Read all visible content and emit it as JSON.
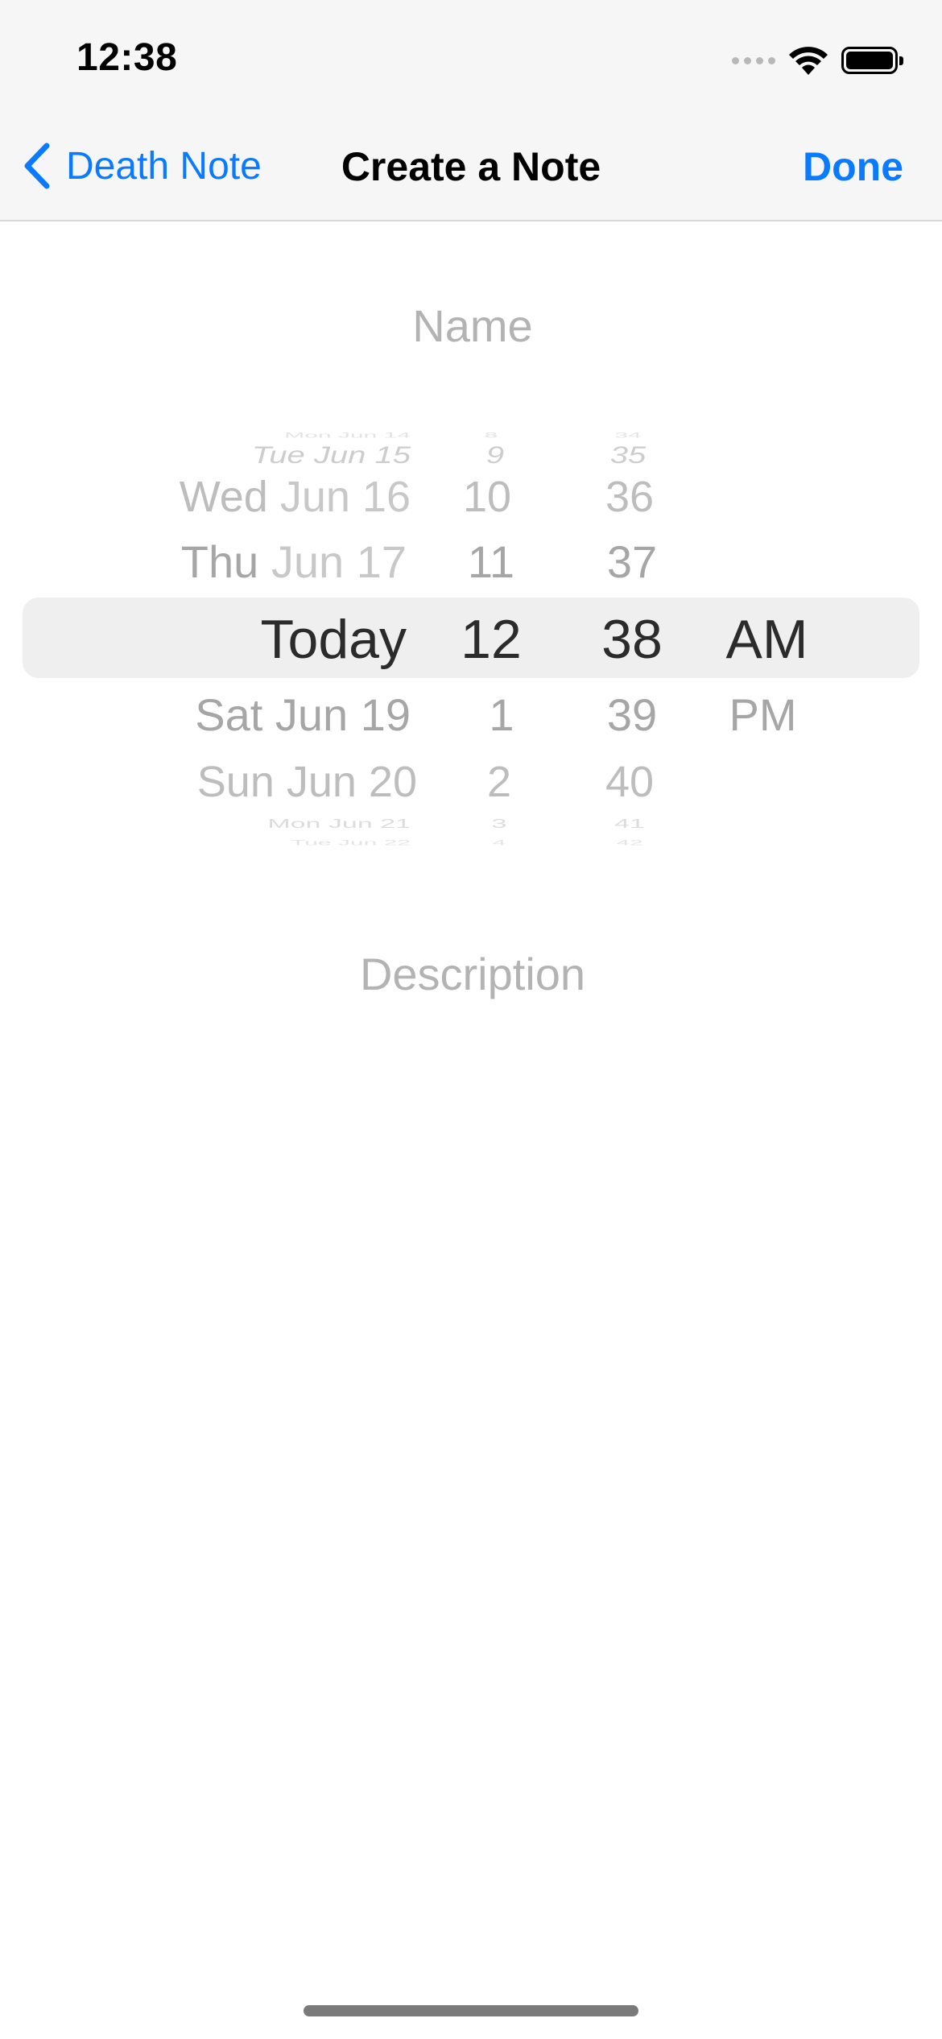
{
  "status_bar": {
    "time": "12:38",
    "signal_icon": "signal-dots-icon",
    "wifi_icon": "wifi-icon",
    "battery_icon": "battery-icon"
  },
  "nav": {
    "back_icon": "chevron-left-icon",
    "back_label": "Death Note",
    "title": "Create a Note",
    "done_label": "Done"
  },
  "form": {
    "name_placeholder": "Name",
    "name_value": "",
    "description_placeholder": "Description",
    "description_value": ""
  },
  "date_picker": {
    "date_column": {
      "above": [
        {
          "weekday": "Mon",
          "date": "Jun 14"
        },
        {
          "weekday": "Tue",
          "date": "Jun 15"
        },
        {
          "weekday": "Wed",
          "date": "Jun 16"
        },
        {
          "weekday": "Thu",
          "date": "Jun 17"
        }
      ],
      "selected": "Today",
      "below": [
        "Sat Jun 19",
        "Sun Jun 20",
        "Mon Jun 21",
        "Tue Jun 22"
      ]
    },
    "hour_column": {
      "above": [
        "8",
        "9",
        "10",
        "11"
      ],
      "selected": "12",
      "below": [
        "1",
        "2",
        "3",
        "4"
      ]
    },
    "minute_column": {
      "above": [
        "34",
        "35",
        "36",
        "37"
      ],
      "selected": "38",
      "below": [
        "39",
        "40",
        "41",
        "42"
      ]
    },
    "period_column": {
      "selected": "AM",
      "below": [
        "PM"
      ]
    }
  },
  "colors": {
    "accent": "#0a7aff",
    "nav_background": "#f6f6f6",
    "placeholder": "#b3b3b3",
    "picker_highlight": "#efefef"
  }
}
